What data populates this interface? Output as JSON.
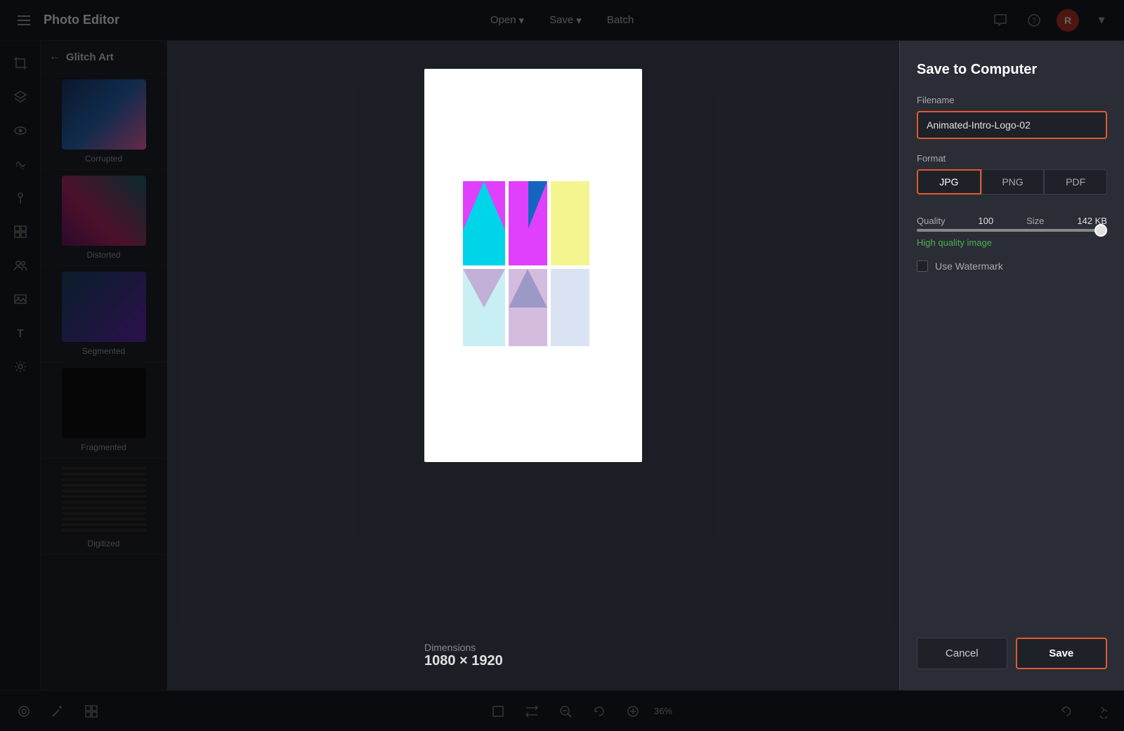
{
  "app": {
    "title": "Photo Editor"
  },
  "topbar": {
    "open_label": "Open",
    "save_label": "Save",
    "batch_label": "Batch",
    "avatar_initial": "R"
  },
  "panel": {
    "back_label": "←",
    "title": "Glitch Art",
    "items": [
      {
        "label": "Corrupted",
        "id": "corrupted"
      },
      {
        "label": "Distorted",
        "id": "distorted"
      },
      {
        "label": "Segmented",
        "id": "segmented"
      },
      {
        "label": "Fragmented",
        "id": "fragmented"
      },
      {
        "label": "Digitized",
        "id": "digitized"
      }
    ]
  },
  "preview": {
    "dimensions_label": "Dimensions",
    "dimensions_value": "1080 × 1920"
  },
  "dialog": {
    "title": "Save to Computer",
    "filename_label": "Filename",
    "filename_value": "Animated-Intro-Logo-02",
    "format_label": "Format",
    "formats": [
      "JPG",
      "PNG",
      "PDF"
    ],
    "active_format": "JPG",
    "quality_label": "Quality",
    "quality_value": "100",
    "size_label": "Size",
    "size_value": "142 KB",
    "quality_description": "High quality image",
    "watermark_label": "Use Watermark",
    "cancel_label": "Cancel",
    "save_label": "Save"
  },
  "bottombar": {
    "zoom_label": "36%"
  }
}
